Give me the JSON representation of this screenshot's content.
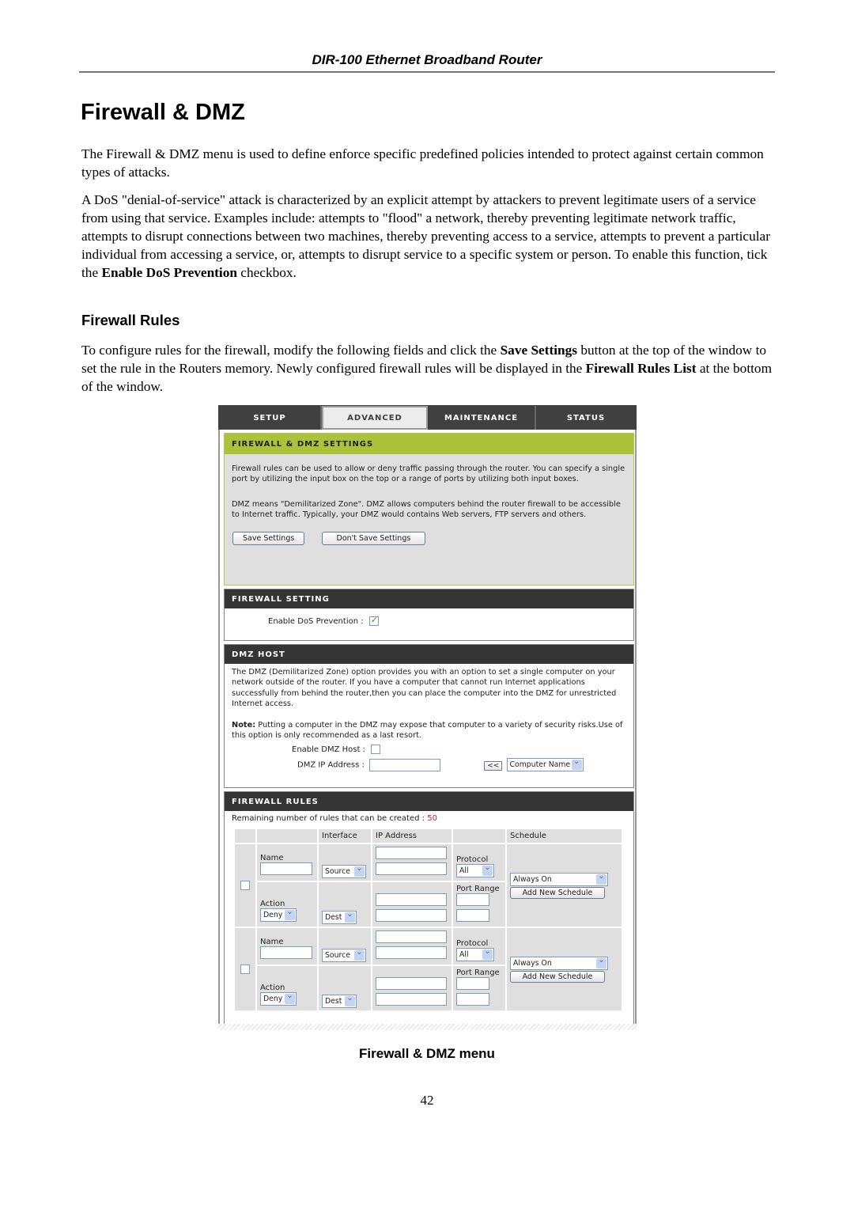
{
  "document": {
    "running_head": "DIR-100 Ethernet Broadband Router",
    "title": "Firewall & DMZ",
    "intro": "The Firewall & DMZ menu is used to define enforce specific predefined policies intended to protect against certain common types of attacks.",
    "dos_paragraph": {
      "text": "A DoS \"denial-of-service\" attack is characterized by an explicit attempt by attackers to prevent legitimate users of a service from using that service. Examples include: attempts to \"flood\" a network, thereby preventing legitimate network traffic, attempts to disrupt connections between two machines, thereby preventing access to a service, attempts to prevent a particular individual from accessing a service, or, attempts to disrupt service to a specific system or person. To enable this function, tick the ",
      "bold": "Enable DoS Prevention",
      "tail": " checkbox."
    },
    "subheading": "Firewall Rules",
    "rules_paragraph": {
      "part1": "To configure rules for the firewall, modify the following fields and click the ",
      "bold1": "Save Settings",
      "part2": " button at the top of the window to set the rule in the Routers memory. Newly configured firewall rules will be displayed in the ",
      "bold2": "Firewall Rules List",
      "part3": " at the bottom of the window."
    },
    "figure_caption": "Firewall & DMZ menu",
    "page_number": "42"
  },
  "router_ui": {
    "tabs": [
      {
        "label": "SETUP",
        "active": false
      },
      {
        "label": "ADVANCED",
        "active": true
      },
      {
        "label": "MAINTENANCE",
        "active": false
      },
      {
        "label": "STATUS",
        "active": false
      }
    ],
    "settings": {
      "header": "FIREWALL & DMZ SETTINGS",
      "desc1": "Firewall rules can be used to allow or deny traffic passing through the router. You can specify a single port by utilizing the input box on the top or a range of ports by utilizing both input boxes.",
      "desc2": "DMZ means \"Demilitarized Zone\". DMZ allows computers behind the router firewall to be accessible to Internet traffic. Typically, your DMZ would contains Web servers, FTP servers and others.",
      "save_button": "Save Settings",
      "dont_save_button": "Don't Save Settings"
    },
    "firewall_setting": {
      "header": "FIREWALL SETTING",
      "dos_label": "Enable DoS Prevention :",
      "dos_checked": true
    },
    "dmz_host": {
      "header": "DMZ HOST",
      "desc": "The DMZ (Demilitarized Zone) option provides you with an option to set a single computer on your network outside of the router. If you have a computer that cannot run Internet applications successfully from behind the router,then you can place the computer into the DMZ for unrestricted Internet access.",
      "note_label": "Note:",
      "note_text": " Putting a computer in the DMZ may expose that computer to a variety of security risks.Use of this option is only recommended as a last resort.",
      "enable_label": "Enable DMZ Host :",
      "enable_checked": false,
      "ip_label": "DMZ IP Address :",
      "ip_value": "",
      "copy_button": "<<",
      "computer_select": "Computer Name"
    },
    "firewall_rules": {
      "header": "FIREWALL RULES",
      "remaining_label": "Remaining number of rules that can be created : ",
      "remaining_value": "50",
      "remaining_color": "#cc2222",
      "columns": [
        "",
        "",
        "Interface",
        "IP Address",
        "",
        "Schedule"
      ],
      "rules": [
        {
          "checked": false,
          "name_label": "Name",
          "name": "",
          "action_label": "Action",
          "action": "Deny",
          "source_iface": "Source",
          "dest_iface": "Dest",
          "protocol_label": "Protocol",
          "protocol": "All",
          "port_range_label": "Port Range",
          "schedule": "Always On",
          "add_schedule_button": "Add New Schedule"
        },
        {
          "checked": false,
          "name_label": "Name",
          "name": "",
          "action_label": "Action",
          "action": "Deny",
          "source_iface": "Source",
          "dest_iface": "Dest",
          "protocol_label": "Protocol",
          "protocol": "All",
          "port_range_label": "Port Range",
          "schedule": "Always On",
          "add_schedule_button": "Add New Schedule"
        }
      ]
    }
  }
}
